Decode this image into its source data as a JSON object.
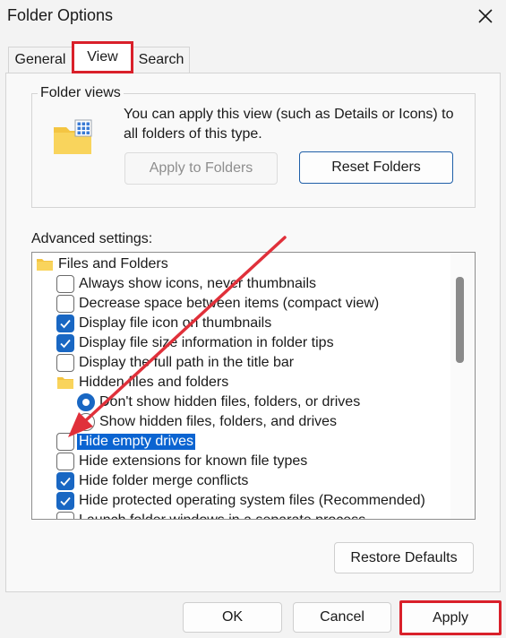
{
  "window": {
    "title": "Folder Options"
  },
  "tabs": [
    {
      "label": "General"
    },
    {
      "label": "View"
    },
    {
      "label": "Search"
    }
  ],
  "folder_views": {
    "heading": "Folder views",
    "description": "You can apply this view (such as Details or Icons) to all folders of this type.",
    "apply_button": "Apply to Folders",
    "reset_button": "Reset Folders"
  },
  "advanced": {
    "heading": "Advanced settings:",
    "items": [
      {
        "kind": "folder",
        "label": "Files and Folders"
      },
      {
        "kind": "checkbox",
        "checked": false,
        "label": "Always show icons, never thumbnails"
      },
      {
        "kind": "checkbox",
        "checked": false,
        "label": "Decrease space between items (compact view)"
      },
      {
        "kind": "checkbox",
        "checked": true,
        "label": "Display file icon on thumbnails"
      },
      {
        "kind": "checkbox",
        "checked": true,
        "label": "Display file size information in folder tips"
      },
      {
        "kind": "checkbox",
        "checked": false,
        "label": "Display the full path in the title bar"
      },
      {
        "kind": "folder",
        "label": "Hidden files and folders"
      },
      {
        "kind": "radio",
        "checked": true,
        "label": "Don't show hidden files, folders, or drives"
      },
      {
        "kind": "radio",
        "checked": false,
        "label": "Show hidden files, folders, and drives"
      },
      {
        "kind": "checkbox",
        "checked": false,
        "selected": true,
        "label": "Hide empty drives"
      },
      {
        "kind": "checkbox",
        "checked": false,
        "label": "Hide extensions for known file types"
      },
      {
        "kind": "checkbox",
        "checked": true,
        "label": "Hide folder merge conflicts"
      },
      {
        "kind": "checkbox",
        "checked": true,
        "label": "Hide protected operating system files (Recommended)"
      },
      {
        "kind": "checkbox",
        "checked": false,
        "label": "Launch folder windows in a separate process"
      }
    ]
  },
  "buttons": {
    "restore_defaults": "Restore Defaults",
    "ok": "OK",
    "cancel": "Cancel",
    "apply": "Apply"
  },
  "colors": {
    "accent": "#1967c3",
    "selection": "#0b64d1",
    "highlight_box": "#d9202a",
    "annotation_arrow": "#e0303a"
  },
  "icons": {
    "close": "close-icon",
    "folder_view": "folder-view-icon",
    "folder": "folder-icon",
    "checkmark": "checkmark-icon"
  }
}
